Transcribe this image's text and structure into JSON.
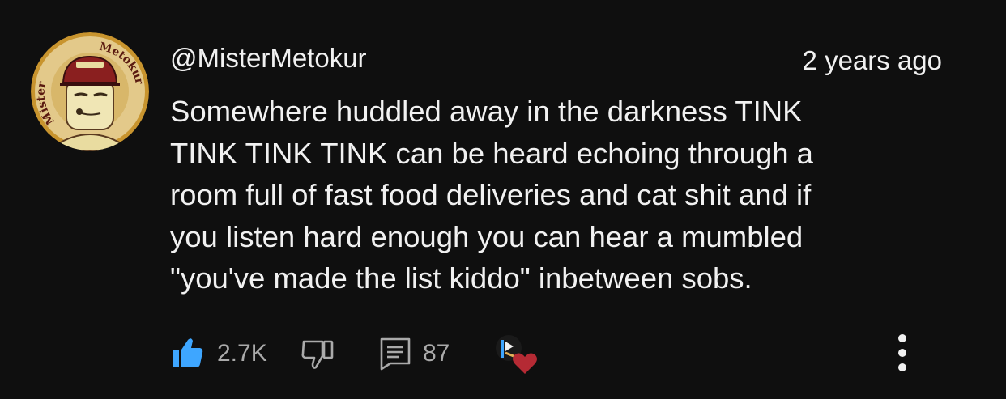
{
  "comment": {
    "author": "@MisterMetokur",
    "timestamp": "2 years ago",
    "text": "Somewhere huddled away in the darkness TINK\nTINK TINK TINK can be heard echoing through a\nroom full of fast food deliveries and cat shit and if\nyou listen hard enough you can hear a mumbled\n\"you've made the list kiddo\" inbetween sobs.",
    "avatar": {
      "ring_text_left": "Mister",
      "ring_text_right": "Metokur",
      "ring_color": "#c8942e",
      "face_color": "#e9dca0",
      "hat_color": "#8a1f1f"
    },
    "actions": {
      "like_count": "2.7K",
      "reply_count": "87",
      "like_icon": "thumbs-up-icon",
      "dislike_icon": "thumbs-down-icon",
      "reply_icon": "reply-icon",
      "creator_heart_icon": "creator-heart-icon",
      "more_icon": "more-vertical-icon"
    },
    "colors": {
      "background": "#0f0f0f",
      "text": "#f1f1f1",
      "secondary_text": "#aaaaaa",
      "like_active": "#3ea6ff",
      "heart": "#b52a34"
    }
  }
}
